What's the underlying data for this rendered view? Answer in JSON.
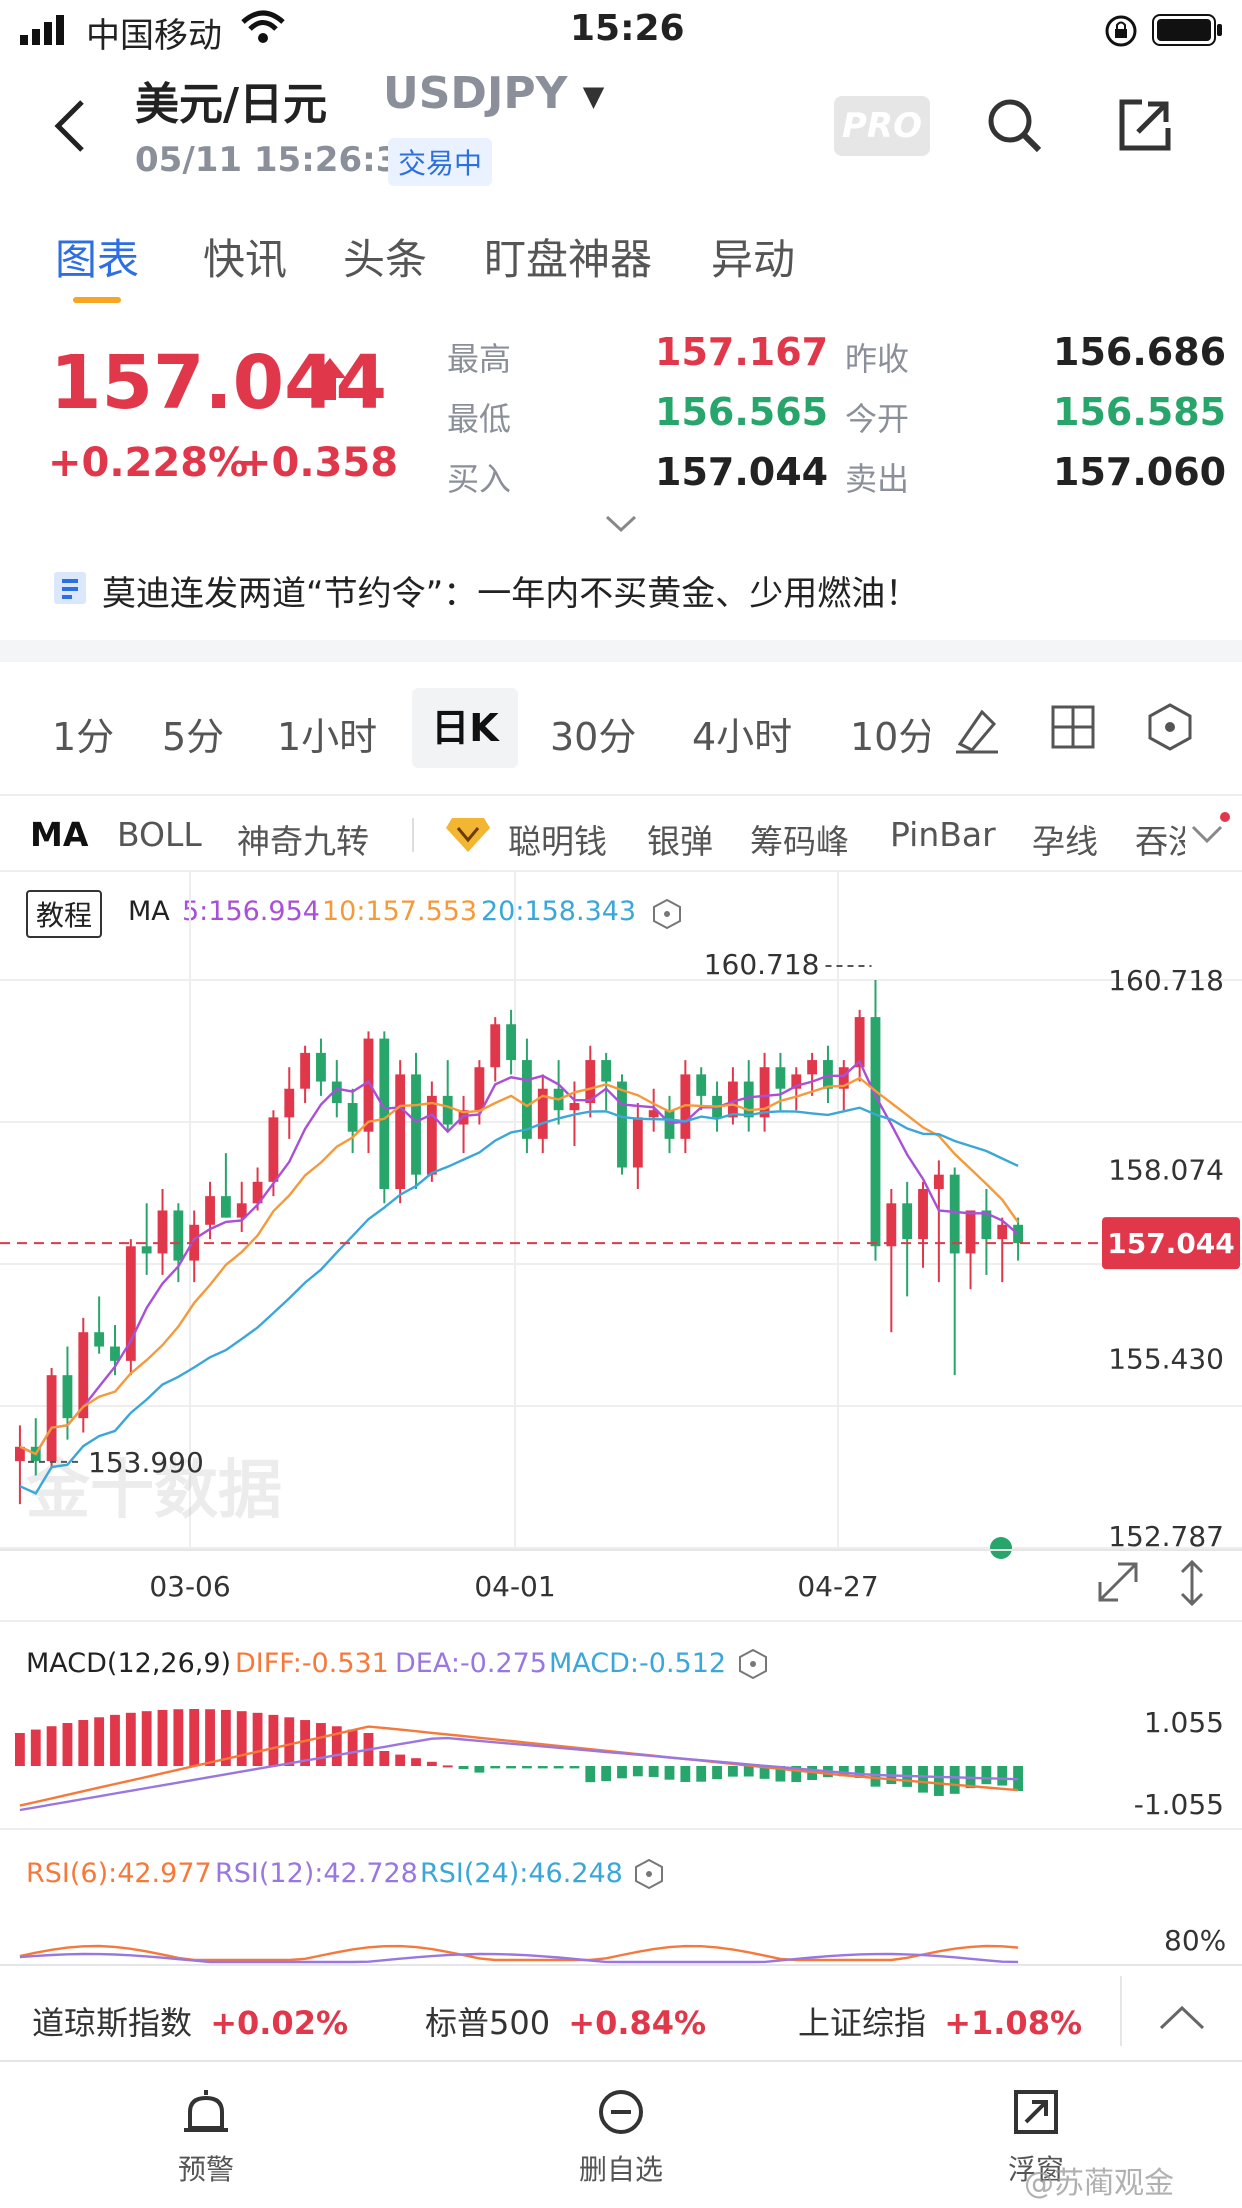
{
  "status_bar": {
    "carrier": "中国移动",
    "time": "15:26"
  },
  "header": {
    "title": "美元/日元",
    "symbol": "USDJPY",
    "datetime": "05/11 15:26:34",
    "trade_status": "交易中",
    "pro_label": "PRO"
  },
  "tabs": [
    {
      "label": "图表",
      "active": true
    },
    {
      "label": "快讯",
      "active": false
    },
    {
      "label": "头条",
      "active": false
    },
    {
      "label": "盯盘神器",
      "active": false
    },
    {
      "label": "异动",
      "active": false
    }
  ],
  "quote": {
    "price": "157.044",
    "change_pct": "+0.228%",
    "change": "+0.358",
    "high_label": "最高",
    "high": "157.167",
    "low_label": "最低",
    "low": "156.565",
    "bid_label": "买入",
    "bid": "157.044",
    "prev_close_label": "昨收",
    "prev_close": "156.686",
    "open_label": "今开",
    "open": "156.585",
    "ask_label": "卖出",
    "ask": "157.060"
  },
  "news": {
    "headline": "莫迪连发两道“节约令”：一年内不买黄金、少用燃油！"
  },
  "timeframes": [
    {
      "label": "1分",
      "active": false
    },
    {
      "label": "5分",
      "active": false
    },
    {
      "label": "1小时",
      "active": false
    },
    {
      "label": "日K",
      "active": true
    },
    {
      "label": "30分",
      "active": false
    },
    {
      "label": "4小时",
      "active": false
    },
    {
      "label": "10分",
      "active": false
    }
  ],
  "indicators": [
    {
      "label": "MA",
      "active": true
    },
    {
      "label": "BOLL",
      "active": false
    },
    {
      "label": "神奇九转",
      "active": false
    },
    {
      "label": "聪明钱",
      "active": false
    },
    {
      "label": "银弹",
      "active": false
    },
    {
      "label": "筹码峰",
      "active": false
    },
    {
      "label": "PinBar",
      "active": false
    },
    {
      "label": "孕线",
      "active": false
    },
    {
      "label": "吞没",
      "active": false
    }
  ],
  "ma_legend": {
    "tutorial": "教程",
    "title": "MA",
    "ma5": "5:156.954",
    "ma10": "10:157.553",
    "ma20": "20:158.343"
  },
  "colors": {
    "up": "#e0374a",
    "down": "#27a56b",
    "ma5": "#a94fd8",
    "ma10": "#f59a3a",
    "ma20": "#3aa7d8",
    "accent": "#2d6fe0"
  },
  "chart_data": {
    "type": "candlestick",
    "y_ticks": [
      "160.718",
      "158.074",
      "155.430",
      "152.787"
    ],
    "ylim": [
      152.787,
      160.718
    ],
    "x_ticks": [
      "03-06",
      "04-01",
      "04-27"
    ],
    "current_price": "157.044",
    "high_marker": "160.718",
    "low_marker": "153.990",
    "watermark": "金十数据",
    "candles": [
      [
        154.0,
        154.5,
        153.4,
        154.2
      ],
      [
        154.2,
        154.6,
        153.8,
        154.0
      ],
      [
        154.0,
        155.3,
        153.9,
        155.2
      ],
      [
        155.2,
        155.6,
        154.3,
        154.6
      ],
      [
        154.6,
        156.0,
        154.4,
        155.8
      ],
      [
        155.8,
        156.3,
        155.5,
        155.6
      ],
      [
        155.6,
        155.9,
        155.2,
        155.4
      ],
      [
        155.4,
        157.1,
        155.2,
        157.0
      ],
      [
        157.0,
        157.6,
        156.6,
        156.9
      ],
      [
        156.9,
        157.8,
        156.6,
        157.5
      ],
      [
        157.5,
        157.6,
        156.5,
        156.8
      ],
      [
        156.8,
        157.5,
        156.5,
        157.3
      ],
      [
        157.3,
        157.9,
        157.1,
        157.7
      ],
      [
        157.7,
        158.3,
        157.4,
        157.4
      ],
      [
        157.4,
        157.9,
        157.2,
        157.6
      ],
      [
        157.6,
        158.1,
        157.5,
        157.9
      ],
      [
        157.9,
        158.9,
        157.7,
        158.8
      ],
      [
        158.8,
        159.5,
        158.5,
        159.2
      ],
      [
        159.2,
        159.8,
        159.0,
        159.7
      ],
      [
        159.7,
        159.9,
        159.1,
        159.3
      ],
      [
        159.3,
        159.6,
        158.8,
        159.0
      ],
      [
        159.0,
        159.2,
        158.3,
        158.6
      ],
      [
        158.6,
        160.0,
        158.3,
        159.9
      ],
      [
        159.9,
        160.0,
        157.6,
        157.8
      ],
      [
        157.8,
        159.6,
        157.6,
        159.4
      ],
      [
        159.4,
        159.7,
        157.8,
        158.0
      ],
      [
        158.0,
        159.3,
        157.9,
        159.1
      ],
      [
        159.1,
        159.6,
        158.6,
        158.7
      ],
      [
        158.7,
        159.1,
        158.3,
        158.9
      ],
      [
        158.9,
        159.6,
        158.7,
        159.5
      ],
      [
        159.5,
        160.2,
        159.3,
        160.1
      ],
      [
        160.1,
        160.3,
        159.4,
        159.6
      ],
      [
        159.6,
        159.9,
        158.3,
        158.5
      ],
      [
        158.5,
        159.4,
        158.3,
        159.2
      ],
      [
        159.2,
        159.6,
        158.7,
        158.9
      ],
      [
        158.9,
        159.3,
        158.4,
        159.0
      ],
      [
        159.0,
        159.8,
        158.8,
        159.6
      ],
      [
        159.6,
        159.7,
        158.9,
        159.3
      ],
      [
        159.3,
        159.4,
        158.0,
        158.1
      ],
      [
        158.1,
        159.0,
        157.8,
        158.8
      ],
      [
        158.8,
        159.2,
        158.6,
        158.9
      ],
      [
        158.9,
        159.1,
        158.3,
        158.5
      ],
      [
        158.5,
        159.6,
        158.3,
        159.4
      ],
      [
        159.4,
        159.5,
        158.9,
        159.1
      ],
      [
        159.1,
        159.3,
        158.6,
        158.8
      ],
      [
        158.8,
        159.5,
        158.7,
        159.3
      ],
      [
        159.3,
        159.6,
        158.6,
        158.8
      ],
      [
        158.8,
        159.7,
        158.6,
        159.5
      ],
      [
        159.5,
        159.7,
        158.9,
        159.2
      ],
      [
        159.2,
        159.5,
        158.9,
        159.4
      ],
      [
        159.4,
        159.7,
        159.1,
        159.6
      ],
      [
        159.6,
        159.8,
        159.0,
        159.2
      ],
      [
        159.2,
        159.6,
        158.9,
        159.5
      ],
      [
        159.5,
        160.3,
        159.3,
        160.2
      ],
      [
        160.2,
        160.718,
        156.8,
        157.0
      ],
      [
        157.0,
        157.8,
        155.8,
        157.6
      ],
      [
        157.6,
        157.9,
        156.3,
        157.1
      ],
      [
        157.1,
        157.9,
        156.7,
        157.8
      ],
      [
        157.8,
        158.2,
        156.5,
        158.0
      ],
      [
        158.0,
        158.1,
        155.2,
        156.9
      ],
      [
        156.9,
        157.2,
        156.4,
        157.5
      ],
      [
        157.5,
        157.8,
        156.6,
        157.1
      ],
      [
        157.1,
        157.4,
        156.5,
        157.3
      ],
      [
        157.3,
        157.4,
        156.8,
        157.044
      ]
    ]
  },
  "macd": {
    "title": "MACD(12,26,9)",
    "diff": "DIFF:-0.531",
    "dea": "DEA:-0.275",
    "macd": "MACD:-0.512",
    "top": "1.055",
    "bottom": "-1.055"
  },
  "rsi": {
    "r6": "RSI(6):42.977",
    "r12": "RSI(12):42.728",
    "r24": "RSI(24):46.248",
    "top": "80%"
  },
  "ticker": [
    {
      "name": "道琼斯指数",
      "value": "+0.02%"
    },
    {
      "name": "标普500",
      "value": "+0.84%"
    },
    {
      "name": "上证综指",
      "value": "+1.08%"
    }
  ],
  "nav": [
    {
      "label": "预警"
    },
    {
      "label": "删自选"
    },
    {
      "label": "浮窗"
    }
  ],
  "watermark_corner": "@苏蔺观金"
}
